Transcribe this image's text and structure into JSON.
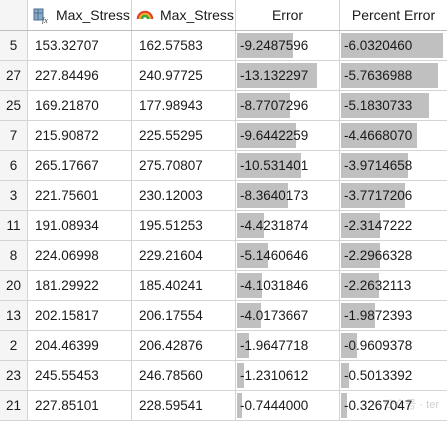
{
  "header": {
    "col1": "Max_Stress",
    "col2": "Max_Stress",
    "col3": "Error",
    "col4": "Percent Error"
  },
  "bar_max": {
    "error": 13.132297,
    "percent_error": 6.032046
  },
  "rows": [
    {
      "id": "5",
      "a": "153.32707",
      "b": "162.57583",
      "err": "-9.2487596",
      "pct": "-6.0320460",
      "err_v": 9.2487596,
      "pct_v": 6.032046
    },
    {
      "id": "27",
      "a": "227.84496",
      "b": "240.97725",
      "err": "-13.132297",
      "pct": "-5.7636988",
      "err_v": 13.132297,
      "pct_v": 5.7636988
    },
    {
      "id": "25",
      "a": "169.21870",
      "b": "177.98943",
      "err": "-8.7707296",
      "pct": "-5.1830733",
      "err_v": 8.7707296,
      "pct_v": 5.1830733
    },
    {
      "id": "7",
      "a": "215.90872",
      "b": "225.55295",
      "err": "-9.6442259",
      "pct": "-4.4668070",
      "err_v": 9.6442259,
      "pct_v": 4.466807
    },
    {
      "id": "6",
      "a": "265.17667",
      "b": "275.70807",
      "err": "-10.531401",
      "pct": "-3.9714658",
      "err_v": 10.531401,
      "pct_v": 3.9714658
    },
    {
      "id": "3",
      "a": "221.75601",
      "b": "230.12003",
      "err": "-8.3640173",
      "pct": "-3.7717206",
      "err_v": 8.3640173,
      "pct_v": 3.7717206
    },
    {
      "id": "11",
      "a": "191.08934",
      "b": "195.51253",
      "err": "-4.4231874",
      "pct": "-2.3147222",
      "err_v": 4.4231874,
      "pct_v": 2.3147222
    },
    {
      "id": "8",
      "a": "224.06998",
      "b": "229.21604",
      "err": "-5.1460646",
      "pct": "-2.2966328",
      "err_v": 5.1460646,
      "pct_v": 2.2966328
    },
    {
      "id": "20",
      "a": "181.29922",
      "b": "185.40241",
      "err": "-4.1031846",
      "pct": "-2.2632113",
      "err_v": 4.1031846,
      "pct_v": 2.2632113
    },
    {
      "id": "13",
      "a": "202.15817",
      "b": "206.17554",
      "err": "-4.0173667",
      "pct": "-1.9872393",
      "err_v": 4.0173667,
      "pct_v": 1.9872393
    },
    {
      "id": "2",
      "a": "204.46399",
      "b": "206.42876",
      "err": "-1.9647718",
      "pct": "-0.9609378",
      "err_v": 1.9647718,
      "pct_v": 0.9609378
    },
    {
      "id": "23",
      "a": "245.55453",
      "b": "246.78560",
      "err": "-1.2310612",
      "pct": "-0.5013392",
      "err_v": 1.2310612,
      "pct_v": 0.5013392
    },
    {
      "id": "21",
      "a": "227.85101",
      "b": "228.59541",
      "err": "-0.7444000",
      "pct": "-0.3267047",
      "err_v": 0.7444,
      "pct_v": 0.3267047
    }
  ],
  "icons": {
    "col1": "formula-column-icon",
    "col2": "prediction-column-icon"
  }
}
